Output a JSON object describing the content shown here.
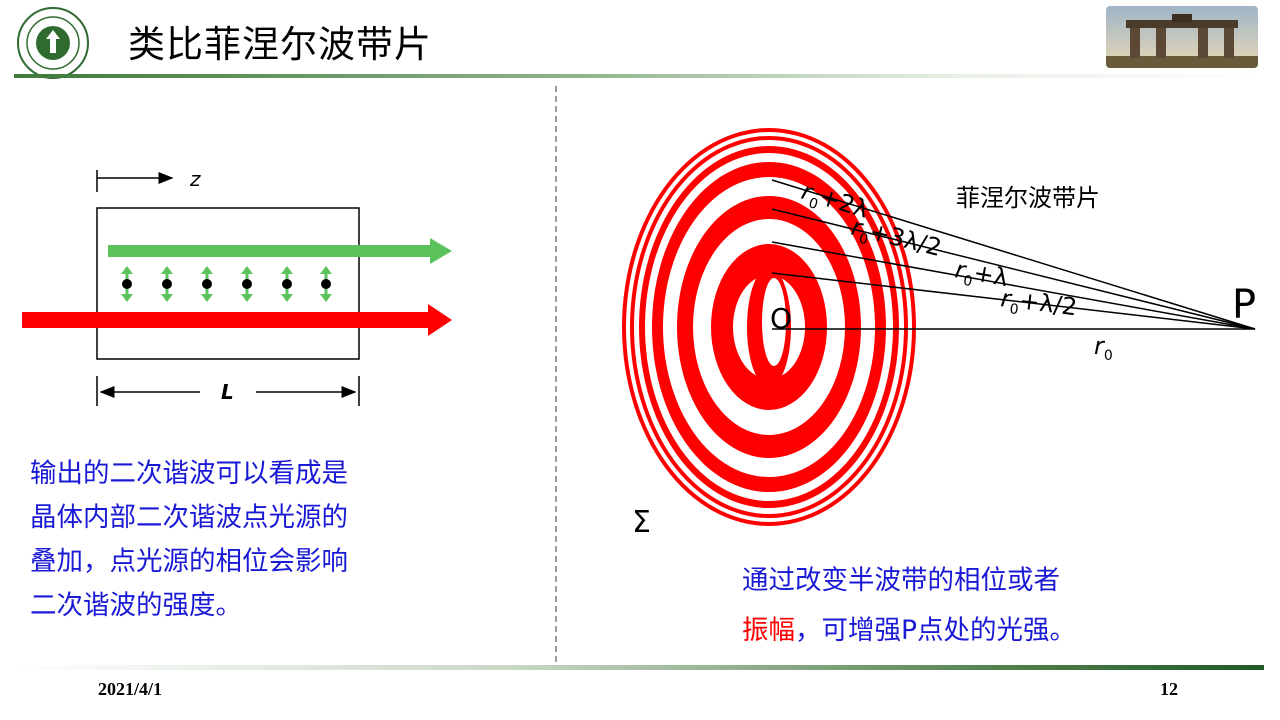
{
  "header": {
    "title": "类比菲涅尔波带片",
    "logo_text": "中山大學 SUN YAT-SEN UNIVERSITY"
  },
  "left_diagram": {
    "z_label": "z",
    "L_label": "L"
  },
  "left_text": {
    "lines": [
      "输出的二次谐波可以看成是",
      "晶体内部二次谐波点光源的",
      "叠加，点光源的相位会影响",
      "二次谐波的强度。"
    ]
  },
  "right_diagram": {
    "plate_label": "菲涅尔波带片",
    "O_label": "O",
    "P_label": "P",
    "sigma_label": "Σ",
    "r_symbol": "r",
    "r_subscript": "0",
    "labels": {
      "r0": "r",
      "r0_half": "+λ/2",
      "r0_one": "+λ",
      "r0_threehalf": "+3λ/2",
      "r0_two": "+2λ"
    }
  },
  "right_text": {
    "line1": "通过改变半波带的相位或者",
    "line2_red": "振幅",
    "line2_rest": "，可增强P点处的光强。"
  },
  "footer": {
    "date": "2021/4/1",
    "page": "12"
  },
  "colors": {
    "accent_green": "#3f7a3a",
    "text_blue": "#1a1ad6",
    "ring_red": "#ff0000",
    "beam_green": "#5cc35c"
  }
}
